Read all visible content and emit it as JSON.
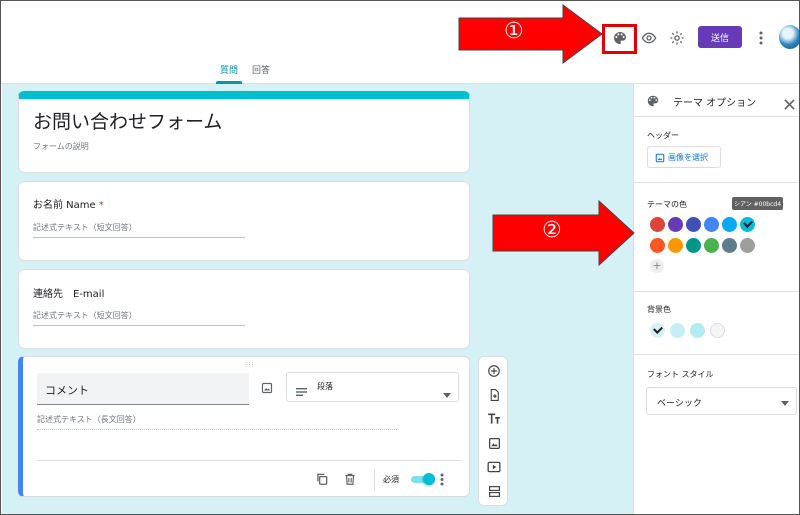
{
  "header": {
    "send_label": "送信",
    "tabs": [
      {
        "label": "質問",
        "active": true
      },
      {
        "label": "回答",
        "active": false
      }
    ]
  },
  "form": {
    "title": "お問い合わせフォーム",
    "description": "フォームの説明",
    "questions": [
      {
        "title": "お名前 Name",
        "required_mark": "*",
        "placeholder": "記述式テキスト（短文回答）"
      },
      {
        "title": "連絡先　E-mail",
        "placeholder": "記述式テキスト（短文回答）"
      }
    ],
    "active_question": {
      "title": "コメント",
      "type_label": "段落",
      "placeholder": "記述式テキスト（長文回答）",
      "required_label": "必須",
      "required_on": true,
      "drag_handle": "⁝⁝⁝"
    }
  },
  "theme_panel": {
    "title": "テーマ オプション",
    "header_label": "ヘッダー",
    "select_image_label": "画像を選択",
    "theme_color_label": "テーマの色",
    "tooltip": "シアン #00bcd4",
    "theme_colors": [
      "#db4437",
      "#673ab7",
      "#3f51b5",
      "#4285f4",
      "#03a9f4",
      "#00bcd4",
      "#ff5722",
      "#ff9800",
      "#009688",
      "#4caf50",
      "#607d8b",
      "#9e9e9e"
    ],
    "selected_theme_color": "#00bcd4",
    "add_color_symbol": "+",
    "bg_color_label": "背景色",
    "bg_colors": [
      "#d5f1f6",
      "#c7eef4",
      "#b2ebf2",
      "#f5f5f5"
    ],
    "font_style_label": "フォント スタイル",
    "font_style_value": "ベーシック"
  },
  "annotations": {
    "step1": "①",
    "step2": "②",
    "arrow_color": "#ff0000"
  }
}
